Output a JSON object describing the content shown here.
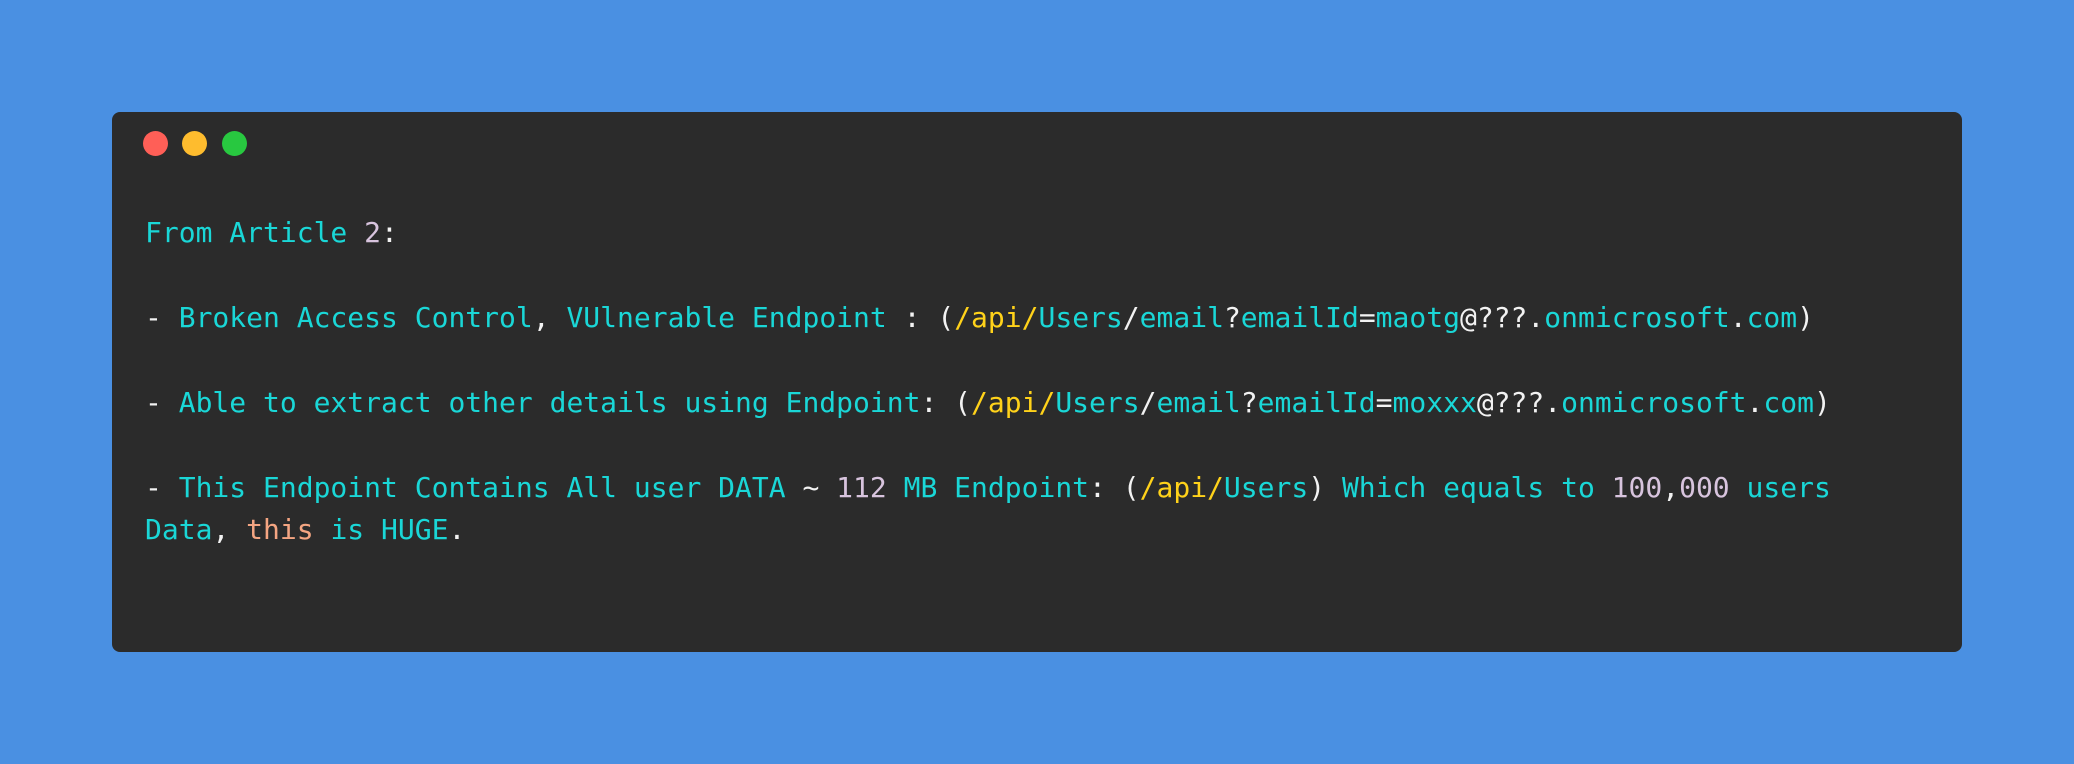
{
  "window": {
    "controls": [
      {
        "name": "close",
        "color": "#ff5f57"
      },
      {
        "name": "minimize",
        "color": "#febc2e"
      },
      {
        "name": "maximize",
        "color": "#28c840"
      }
    ]
  },
  "code_lines": [
    [
      [
        "From Article ",
        "cyan"
      ],
      [
        "2",
        "num"
      ],
      [
        ":",
        "white"
      ]
    ],
    [],
    [
      [
        "- ",
        "white"
      ],
      [
        "Broken Access Control",
        "cyan"
      ],
      [
        ", ",
        "white"
      ],
      [
        "VUlnerable Endpoint",
        "cyan"
      ],
      [
        " : (",
        "white"
      ],
      [
        "/api/",
        "yellow"
      ],
      [
        "Users",
        "cyan"
      ],
      [
        "/",
        "white"
      ],
      [
        "email",
        "cyan"
      ],
      [
        "?",
        "white"
      ],
      [
        "emailId",
        "cyan"
      ],
      [
        "=",
        "white"
      ],
      [
        "maotg",
        "cyan"
      ],
      [
        "@???.",
        "white"
      ],
      [
        "onmicrosoft",
        "cyan"
      ],
      [
        ".",
        "white"
      ],
      [
        "com",
        "cyan"
      ],
      [
        ")",
        "white"
      ]
    ],
    [],
    [
      [
        "- ",
        "white"
      ],
      [
        "Able to extract other details using Endpoint",
        "cyan"
      ],
      [
        ": (",
        "white"
      ],
      [
        "/api/",
        "yellow"
      ],
      [
        "Users",
        "cyan"
      ],
      [
        "/",
        "white"
      ],
      [
        "email",
        "cyan"
      ],
      [
        "?",
        "white"
      ],
      [
        "emailId",
        "cyan"
      ],
      [
        "=",
        "white"
      ],
      [
        "moxxx",
        "cyan"
      ],
      [
        "@???.",
        "white"
      ],
      [
        "onmicrosoft",
        "cyan"
      ],
      [
        ".",
        "white"
      ],
      [
        "com",
        "cyan"
      ],
      [
        ")",
        "white"
      ]
    ],
    [],
    [
      [
        "- ",
        "white"
      ],
      [
        "This Endpoint Contains All user DATA",
        "cyan"
      ],
      [
        " ~ ",
        "white"
      ],
      [
        "112",
        "num"
      ],
      [
        " MB Endpoint",
        "cyan"
      ],
      [
        ": (",
        "white"
      ],
      [
        "/api/",
        "yellow"
      ],
      [
        "Users",
        "cyan"
      ],
      [
        ") ",
        "white"
      ],
      [
        "Which equals to ",
        "cyan"
      ],
      [
        "100",
        "num"
      ],
      [
        ",",
        "white"
      ],
      [
        "000",
        "num"
      ],
      [
        " users",
        "cyan"
      ]
    ],
    [
      [
        "Data",
        "cyan"
      ],
      [
        ", ",
        "white"
      ],
      [
        "this",
        "salmon"
      ],
      [
        " is HUGE",
        "cyan"
      ],
      [
        ".",
        "white"
      ]
    ]
  ]
}
